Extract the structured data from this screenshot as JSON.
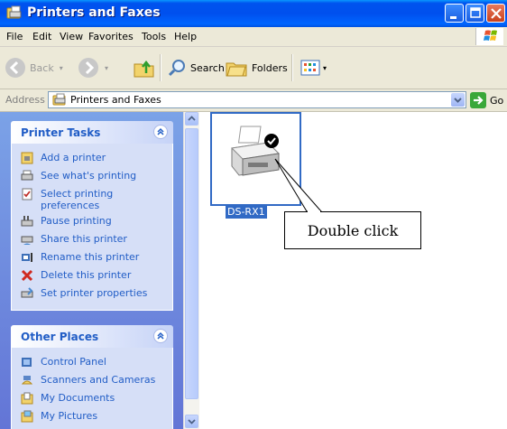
{
  "window": {
    "title": "Printers and Faxes"
  },
  "menu": {
    "file": "File",
    "edit": "Edit",
    "view": "View",
    "favorites": "Favorites",
    "tools": "Tools",
    "help": "Help"
  },
  "toolbar": {
    "back": "Back",
    "search": "Search",
    "folders": "Folders"
  },
  "address": {
    "label": "Address",
    "value": "Printers and Faxes",
    "go": "Go"
  },
  "printer_tasks": {
    "title": "Printer Tasks",
    "items": [
      {
        "label": "Add a printer",
        "icon": "add-printer-icon"
      },
      {
        "label": "See what's printing",
        "icon": "print-queue-icon"
      },
      {
        "label": "Select printing preferences",
        "icon": "preferences-icon"
      },
      {
        "label": "Pause printing",
        "icon": "pause-printer-icon"
      },
      {
        "label": "Share this printer",
        "icon": "share-printer-icon"
      },
      {
        "label": "Rename this printer",
        "icon": "rename-icon"
      },
      {
        "label": "Delete this printer",
        "icon": "delete-icon"
      },
      {
        "label": "Set printer properties",
        "icon": "properties-icon"
      }
    ]
  },
  "other_places": {
    "title": "Other Places",
    "items": [
      {
        "label": "Control Panel",
        "icon": "control-panel-icon"
      },
      {
        "label": "Scanners and Cameras",
        "icon": "scanner-icon"
      },
      {
        "label": "My Documents",
        "icon": "documents-folder-icon"
      },
      {
        "label": "My Pictures",
        "icon": "pictures-folder-icon"
      }
    ]
  },
  "printer": {
    "name": "DS-RX1",
    "icon": "printer-default-icon"
  },
  "annotation": {
    "text": "Double click"
  },
  "colors": {
    "titlebar": "#0053ee",
    "taskpane": "#6f8ee0",
    "link": "#215dc6",
    "selection": "#316ac5"
  }
}
